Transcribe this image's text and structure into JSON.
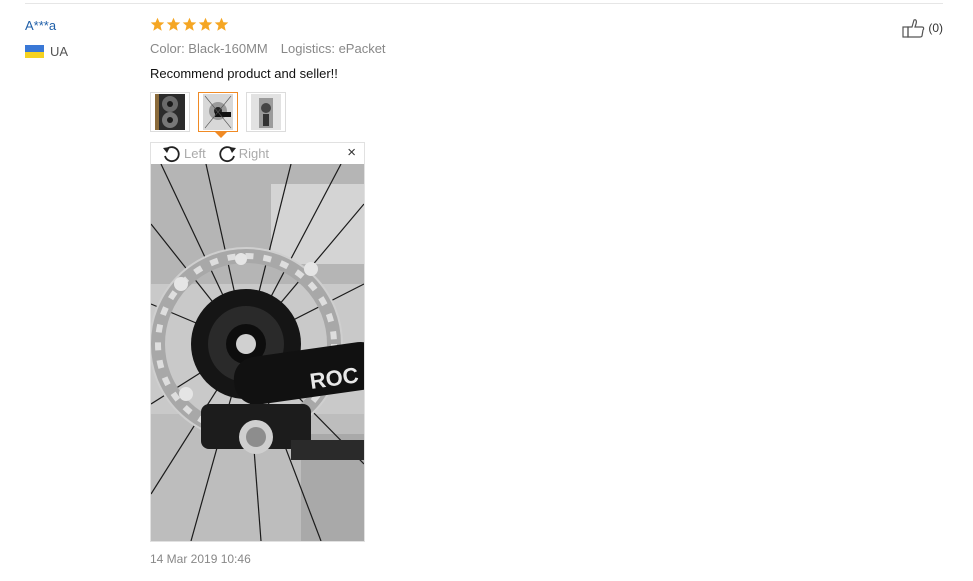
{
  "review": {
    "user_name": "A***a",
    "country_code": "UA",
    "rating": 5,
    "color_label": "Color: Black-160MM",
    "logistics_label": "Logistics: ePacket",
    "text": "Recommend product and seller!!",
    "helpful_count": "(0)",
    "date": "14 Mar 2019 10:46"
  },
  "viewer": {
    "rotate_left_label": "Left",
    "rotate_right_label": "Right",
    "close_symbol": "×"
  },
  "thumbnails": [
    {
      "name": "photo-1",
      "active": false
    },
    {
      "name": "photo-2",
      "active": true
    },
    {
      "name": "photo-3",
      "active": false
    }
  ],
  "colors": {
    "star": "#f5a623",
    "active_thumb_border": "#f08a24",
    "link_blue": "#1f5fa8",
    "flag_blue": "#3a78d6",
    "flag_yellow": "#f5d221"
  },
  "icons": {
    "star": "star-icon",
    "thumbs_up": "thumbs-up-icon",
    "rotate_left": "rotate-left-icon",
    "rotate_right": "rotate-right-icon",
    "close": "close-icon",
    "flag": "ukraine-flag-icon"
  }
}
